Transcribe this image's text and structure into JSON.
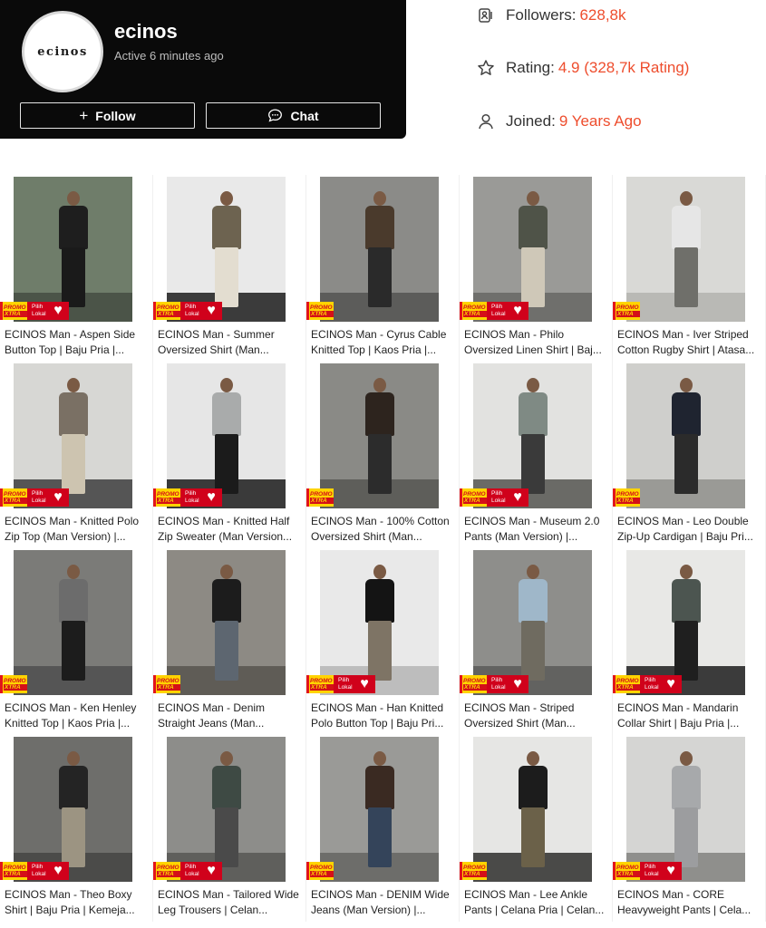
{
  "shop": {
    "logo_text": "ecinos",
    "name": "ecinos",
    "status": "Active 6 minutes ago",
    "follow_label": "Follow",
    "chat_label": "Chat"
  },
  "stats": {
    "followers_label": "Followers:",
    "followers_value": "628,8k",
    "rating_label": "Rating:",
    "rating_value": "4.9 (328,7k Rating)",
    "joined_label": "Joined:",
    "joined_value": "9 Years Ago"
  },
  "badges": {
    "promo_line1": "PROMO",
    "promo_line2": "XTRA",
    "lokal_line1": "Pilih",
    "lokal_line2": "Lokal"
  },
  "colors": {
    "accent": "#ee4d2d",
    "header_bg": "#0a0a0a",
    "promo_yellow": "#ffd400",
    "lokal_red": "#d0011b"
  },
  "products": [
    {
      "title": "ECINOS Man - Aspen Side Button Top | Baju Pria |...",
      "lokal": true
    },
    {
      "title": "ECINOS Man - Summer Oversized Shirt (Man...",
      "lokal": true
    },
    {
      "title": "ECINOS Man - Cyrus Cable Knitted Top | Kaos Pria |...",
      "lokal": false
    },
    {
      "title": "ECINOS Man - Philo Oversized Linen Shirt | Baj...",
      "lokal": true
    },
    {
      "title": "ECINOS Man - Iver Striped Cotton Rugby Shirt | Atasa...",
      "lokal": false
    },
    {
      "title": "ECINOS Man - Knitted Polo Zip Top (Man Version) |...",
      "lokal": true
    },
    {
      "title": "ECINOS Man - Knitted Half Zip Sweater (Man Version...",
      "lokal": true
    },
    {
      "title": "ECINOS Man - 100% Cotton Oversized Shirt (Man...",
      "lokal": false
    },
    {
      "title": "ECINOS Man - Museum 2.0 Pants (Man Version) |...",
      "lokal": true
    },
    {
      "title": "ECINOS Man - Leo Double Zip-Up Cardigan | Baju Pri...",
      "lokal": false
    },
    {
      "title": "ECINOS Man - Ken Henley Knitted Top | Kaos Pria |...",
      "lokal": false
    },
    {
      "title": "ECINOS Man - Denim Straight Jeans (Man...",
      "lokal": false
    },
    {
      "title": "ECINOS Man - Han Knitted Polo Button Top | Baju Pri...",
      "lokal": true
    },
    {
      "title": "ECINOS Man - Striped Oversized Shirt (Man...",
      "lokal": true
    },
    {
      "title": "ECINOS Man - Mandarin Collar Shirt | Baju Pria |...",
      "lokal": true
    },
    {
      "title": "ECINOS Man - Theo Boxy Shirt | Baju Pria | Kemeja...",
      "lokal": true
    },
    {
      "title": "ECINOS Man - Tailored Wide Leg Trousers | Celan...",
      "lokal": true
    },
    {
      "title": "ECINOS Man - DENIM Wide Jeans (Man Version) |...",
      "lokal": false
    },
    {
      "title": "ECINOS Man - Lee Ankle Pants | Celana Pria | Celan...",
      "lokal": false
    },
    {
      "title": "ECINOS Man - CORE Heavyweight Pants | Cela...",
      "lokal": true
    }
  ]
}
